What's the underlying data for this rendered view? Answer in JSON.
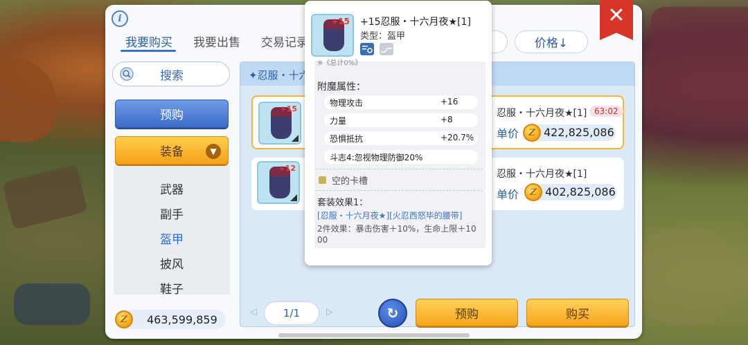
{
  "tabs": [
    {
      "label": "我要购买"
    },
    {
      "label": "我要出售"
    },
    {
      "label": "交易记录"
    }
  ],
  "sort": {
    "label": "价格↓"
  },
  "search": {
    "label": "搜索"
  },
  "sidebar": {
    "preorder_label": "预购",
    "category_label": "装备",
    "sub_items": [
      {
        "label": "武器"
      },
      {
        "label": "副手"
      },
      {
        "label": "盔甲"
      },
      {
        "label": "披风"
      },
      {
        "label": "鞋子"
      }
    ],
    "balance": "463,599,859"
  },
  "list": {
    "header": "✦忍服・十六",
    "rows": [
      {
        "level": "+15",
        "name": "忍服・十六月夜★[1]",
        "timer": "63:02",
        "unit_label": "单价",
        "price": "422,825,086"
      },
      {
        "level": "+12",
        "name": "忍服・十六月夜★[1]",
        "unit_label": "单价",
        "price": "402,825,086"
      }
    ],
    "page": "1/1"
  },
  "actions": {
    "preorder": "预购",
    "buy": "购买"
  },
  "tooltip": {
    "level": "+15",
    "title": "+15忍服・十六月夜★[1]",
    "type": "类型：盔甲",
    "cut_text": "※《总计0%》",
    "enchant_title": "附魔属性：",
    "attrs": [
      {
        "name": "物理攻击",
        "value": "+16"
      },
      {
        "name": "力量",
        "value": "+8"
      },
      {
        "name": "恐惧抵抗",
        "value": "+20.7%"
      }
    ],
    "extra_attr": "斗志4:忽视物理防御20%",
    "slot": "空的卡槽",
    "set_title": "套装效果1：",
    "set_link": "[忍服・十六月夜★][火忍西怒毕的腰带]",
    "set_effect": "2件效果：暴击伤害＋10%，生命上限＋1000"
  },
  "colors": {
    "accent_blue": "#3b73c4",
    "accent_orange": "#f6a51c",
    "close_red": "#d8352a",
    "timer_red": "#c2313a"
  },
  "icons": [
    "info-icon",
    "search-icon",
    "chevron-down-icon",
    "zeny-coin-icon",
    "refresh-icon",
    "close-icon",
    "compare-icon",
    "preview-icon"
  ]
}
